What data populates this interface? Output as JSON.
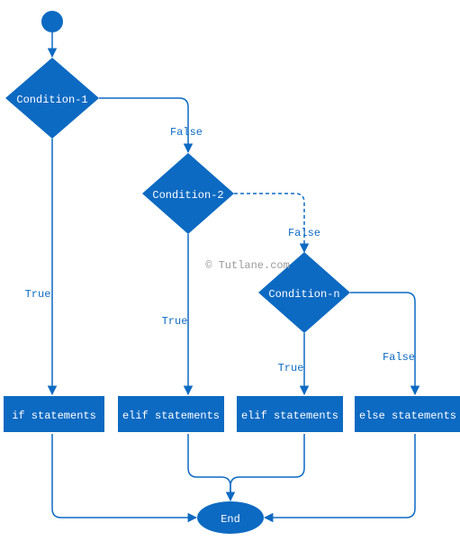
{
  "chart_data": {
    "type": "flowchart",
    "title": "",
    "watermark": "© Tutlane.com",
    "nodes": {
      "start": {
        "kind": "start"
      },
      "cond1": {
        "kind": "decision",
        "label": "Condition-1"
      },
      "cond2": {
        "kind": "decision",
        "label": "Condition-2"
      },
      "condn": {
        "kind": "decision",
        "label": "Condition-n"
      },
      "if": {
        "kind": "process",
        "label": "if statements"
      },
      "elif1": {
        "kind": "process",
        "label": "elif statements"
      },
      "elif2": {
        "kind": "process",
        "label": "elif statements"
      },
      "else": {
        "kind": "process",
        "label": "else statements"
      },
      "end": {
        "kind": "terminator",
        "label": "End"
      }
    },
    "edges": [
      {
        "from": "start",
        "to": "cond1",
        "label": ""
      },
      {
        "from": "cond1",
        "to": "if",
        "label": "True"
      },
      {
        "from": "cond1",
        "to": "cond2",
        "label": "False"
      },
      {
        "from": "cond2",
        "to": "elif1",
        "label": "True"
      },
      {
        "from": "cond2",
        "to": "condn",
        "label": "False",
        "style": "dashed"
      },
      {
        "from": "condn",
        "to": "elif2",
        "label": "True"
      },
      {
        "from": "condn",
        "to": "else",
        "label": "False"
      },
      {
        "from": "if",
        "to": "end",
        "label": ""
      },
      {
        "from": "elif1",
        "to": "end",
        "label": ""
      },
      {
        "from": "elif2",
        "to": "end",
        "label": ""
      },
      {
        "from": "else",
        "to": "end",
        "label": ""
      }
    ]
  }
}
